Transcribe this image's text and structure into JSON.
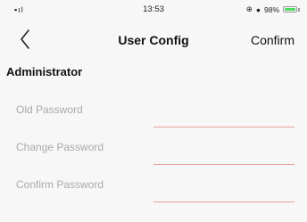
{
  "status_bar": {
    "signal": "▪ıl",
    "time": "13:53",
    "battery_text": "98%",
    "battery_level": 0.98,
    "battery_color": "#4cd964"
  },
  "nav": {
    "title": "User Config",
    "confirm_label": "Confirm",
    "back_icon": "chevron-left-icon"
  },
  "section": {
    "title": "Administrator"
  },
  "form": {
    "old_password": {
      "label": "Old Password",
      "value": ""
    },
    "change_password": {
      "label": "Change Password",
      "value": ""
    },
    "confirm_password": {
      "label": "Confirm Password",
      "value": ""
    }
  },
  "colors": {
    "input_underline": "#e6a3a1",
    "label": "#a9a9a9",
    "background": "#f7f7f8"
  }
}
